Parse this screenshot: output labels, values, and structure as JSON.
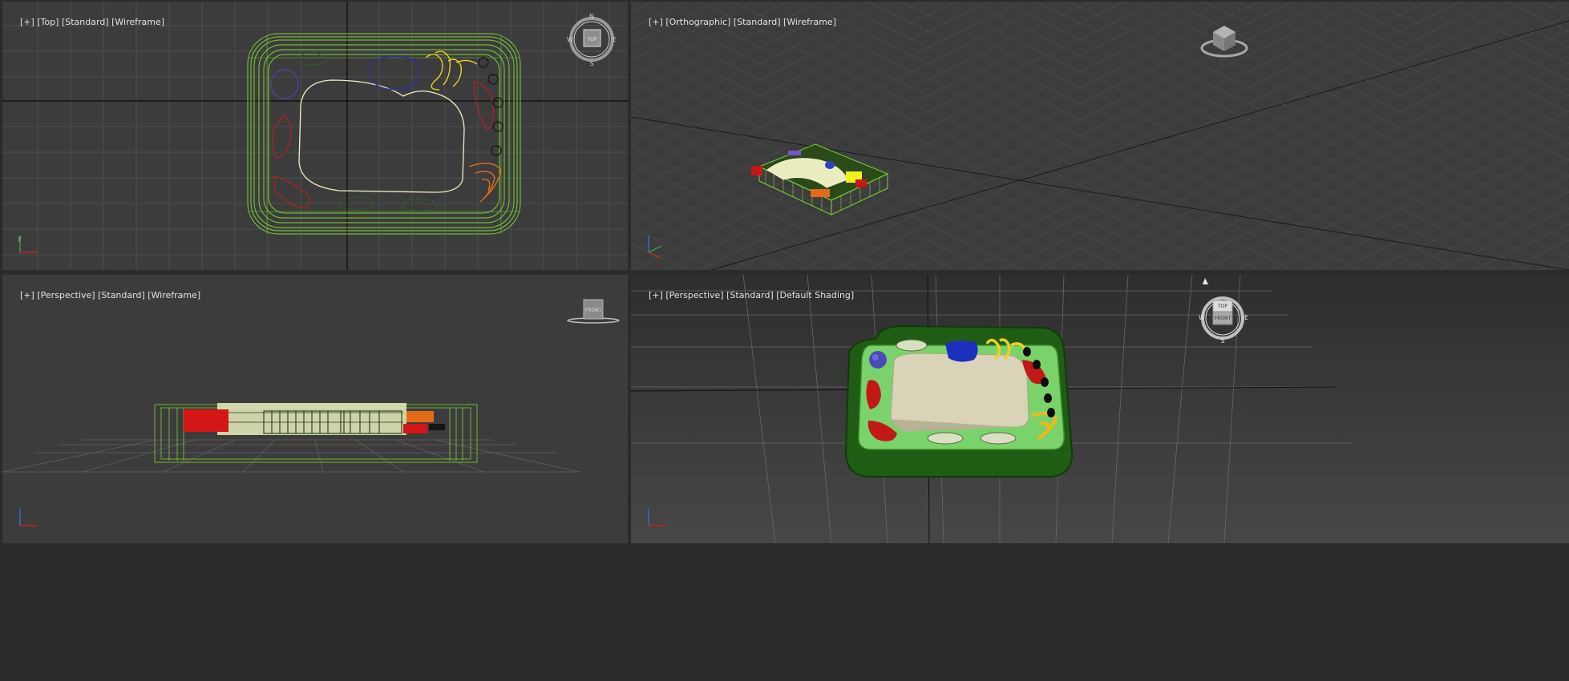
{
  "viewports": {
    "top": {
      "label_plus": "[+]",
      "label_view": "[Top]",
      "label_style": "[Standard]",
      "label_shading": "[Wireframe]",
      "compass": {
        "n": "N",
        "s": "S",
        "e": "E",
        "w": "W",
        "cube": "TOP"
      }
    },
    "ortho": {
      "label_plus": "[+]",
      "label_view": "[Orthographic]",
      "label_style": "[Standard]",
      "label_shading": "[Wireframe]"
    },
    "persp_wire": {
      "label_plus": "[+]",
      "label_view": "[Perspective]",
      "label_style": "[Standard]",
      "label_shading": "[Wireframe]",
      "cube": "FRONT"
    },
    "persp_shaded": {
      "label_plus": "[+]",
      "label_view": "[Perspective]",
      "label_style": "[Standard]",
      "label_shading": "[Default Shading]",
      "cube_top": "TOP",
      "cube_front": "FRONT",
      "compass": {
        "n": "",
        "s": "S",
        "e": "E",
        "w": "W"
      }
    }
  },
  "colors": {
    "viewport_bg": "#3c3c3c",
    "grid": "#555555",
    "grid_major": "#000000",
    "cell_wall": "#7bd433",
    "nucleus": "#f1efc0",
    "active_border": "#b39a3c"
  },
  "icons": [
    "navigation-cube-icon",
    "viewcube-compass-icon",
    "axis-tripod-icon",
    "light-bulb-icon"
  ]
}
